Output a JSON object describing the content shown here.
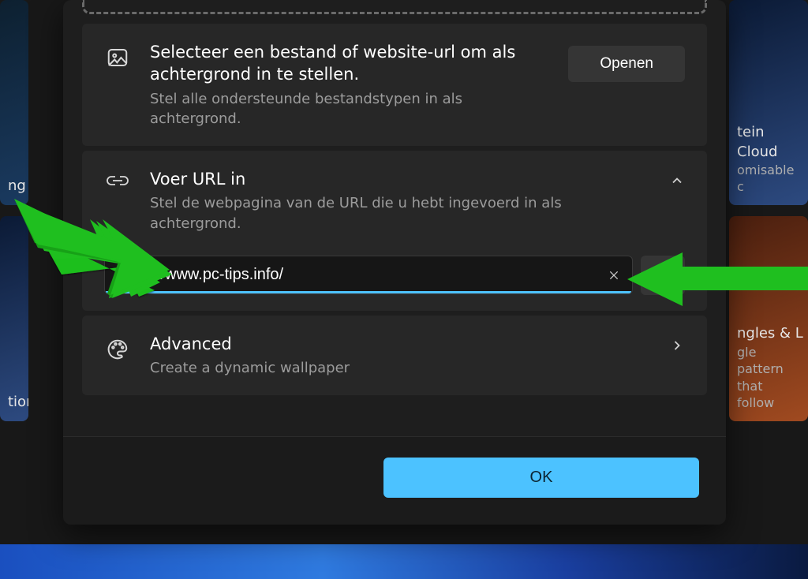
{
  "background_tiles": {
    "right_top": {
      "title": "tein Cloud",
      "subtitle": "omisable c"
    },
    "left_mid": {
      "title": "ng"
    },
    "left_bottom": {
      "title": "tion"
    },
    "right_bottom": {
      "title": "ngles & L",
      "line2": "gle pattern",
      "line3": "that follow"
    }
  },
  "dialog": {
    "select": {
      "heading": "Selecteer een bestand of website-url om als achtergrond in te stellen.",
      "sub": "Stel alle ondersteunde bestandstypen in als achtergrond.",
      "open_label": "Openen"
    },
    "url": {
      "heading": "Voer URL in",
      "sub": "Stel de webpagina van de URL die u hebt ingevoerd in als achtergrond.",
      "value": "https://www.pc-tips.info/"
    },
    "advanced": {
      "heading": "Advanced",
      "sub": "Create a dynamic wallpaper"
    },
    "ok_label": "OK"
  },
  "colors": {
    "accent": "#4cc2ff",
    "arrow": "#1fbf1f"
  }
}
